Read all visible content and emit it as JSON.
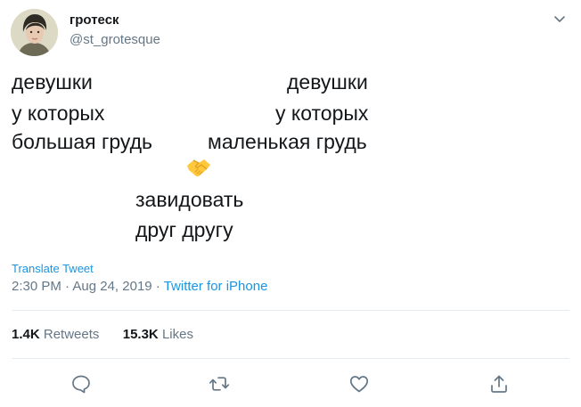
{
  "user": {
    "display_name": "гротеск",
    "handle": "@st_grotesque"
  },
  "tweet": {
    "left_column": [
      "девушки",
      "у которых",
      "большая грудь"
    ],
    "right_column": [
      "девушки",
      "у которых",
      "маленькая грудь"
    ],
    "emoji": "handshake-emoji",
    "center_lines": [
      "завидовать",
      "друг другу"
    ]
  },
  "translate_label": "Translate Tweet",
  "meta": {
    "time": "2:30 PM",
    "separator": " · ",
    "date": "Aug 24, 2019",
    "source": "Twitter for iPhone"
  },
  "stats": {
    "retweets_count": "1.4K",
    "retweets_label": "Retweets",
    "likes_count": "15.3K",
    "likes_label": "Likes"
  },
  "icons": {
    "caret": "chevron-down-icon",
    "reply": "reply-icon",
    "retweet": "retweet-icon",
    "like": "heart-icon",
    "share": "share-icon"
  },
  "colors": {
    "link": "#1b95e0",
    "secondary_text": "#657786",
    "primary_text": "#14171a",
    "divider": "#e6ecf0"
  }
}
